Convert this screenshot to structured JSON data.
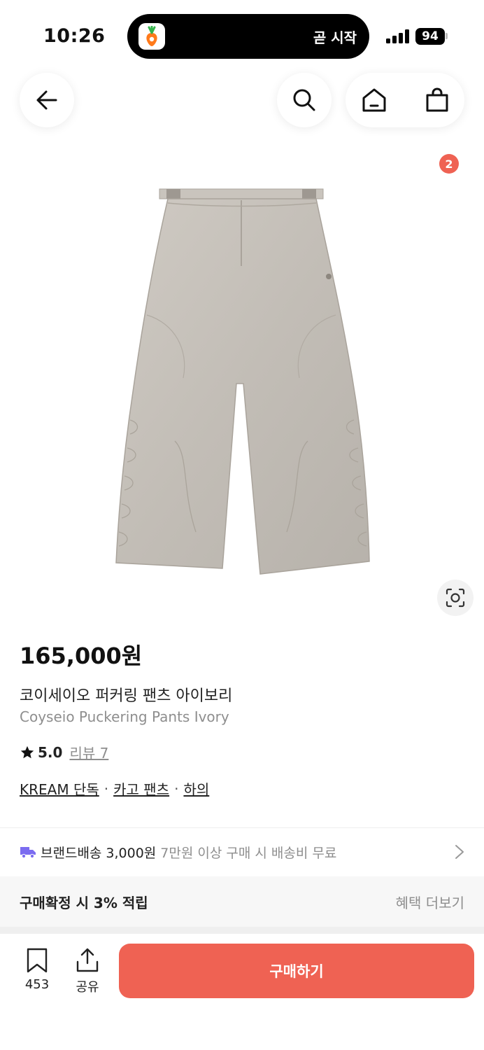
{
  "status_bar": {
    "time": "10:26",
    "live_activity_text": "곧 시작",
    "battery": "94"
  },
  "nav": {
    "cart_count": "2"
  },
  "product": {
    "price": "165,000원",
    "name_ko": "코이세이오 퍼커링 팬츠 아이보리",
    "name_en": "Coyseio Puckering Pants Ivory",
    "rating": "5.0",
    "review_label": "리뷰 7",
    "tags": [
      "KREAM 단독",
      "카고 팬츠",
      "하의"
    ],
    "tag_separator": "·"
  },
  "shipping": {
    "label": "브랜드배송",
    "price": "3,000원",
    "condition": "7만원 이상 구매 시 배송비 무료"
  },
  "points": {
    "text": "구매확정 시 3% 적립",
    "more": "혜택 더보기"
  },
  "bottom_bar": {
    "wish_count": "453",
    "share_label": "공유",
    "buy_label": "구매하기"
  },
  "colors": {
    "accent": "#ef6253",
    "shipping_icon": "#7b6cf0",
    "secondary_text": "#8e8e8e"
  }
}
